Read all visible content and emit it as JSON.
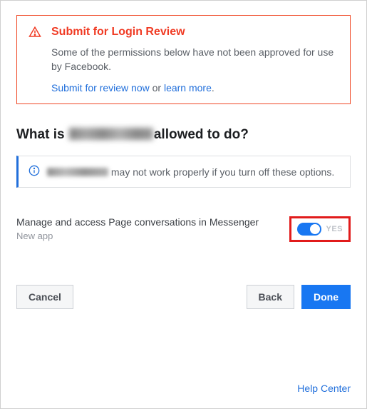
{
  "alert": {
    "title": "Submit for Login Review",
    "body": "Some of the permissions below have not been approved for use by Facebook.",
    "submit_link": "Submit for review now",
    "sep": " or ",
    "learn_link": "learn more",
    "period": "."
  },
  "heading": {
    "prefix": "What is ",
    "suffix": "allowed to do?"
  },
  "info": {
    "text": "may not work properly if you turn off these options."
  },
  "permission": {
    "title": "Manage and access Page conversations in Messenger",
    "sub": "New app",
    "toggle_state": "YES"
  },
  "buttons": {
    "cancel": "Cancel",
    "back": "Back",
    "done": "Done"
  },
  "footer": {
    "help": "Help Center"
  }
}
